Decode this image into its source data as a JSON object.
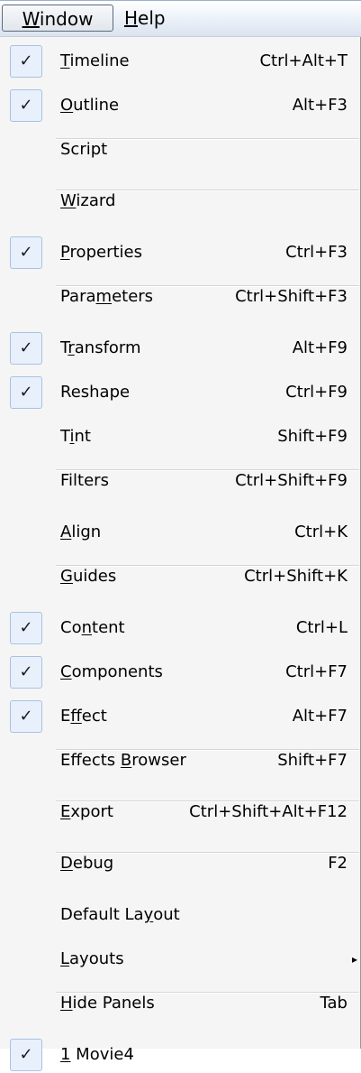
{
  "menubar": {
    "window_label": "Window",
    "help_label": "Help"
  },
  "menu": {
    "check_mark": "✓",
    "submenu_arrow": "▸",
    "items": [
      {
        "label": "Timeline",
        "mnemonic": "T",
        "shortcut": "Ctrl+Alt+T",
        "checked": true
      },
      {
        "label": "Outline",
        "mnemonic": "O",
        "shortcut": "Alt+F3",
        "checked": true
      },
      {
        "label": "Script",
        "mnemonic": "",
        "shortcut": "",
        "checked": false
      },
      {
        "label": "Wizard",
        "mnemonic": "W",
        "shortcut": "",
        "checked": false
      },
      {
        "label": "Properties",
        "mnemonic": "P",
        "shortcut": "Ctrl+F3",
        "checked": true
      },
      {
        "label": "Parameters",
        "mnemonic": "m",
        "shortcut": "Ctrl+Shift+F3",
        "checked": false
      },
      {
        "label": "Transform",
        "mnemonic": "r",
        "shortcut": "Alt+F9",
        "checked": true
      },
      {
        "label": "Reshape",
        "mnemonic": "",
        "shortcut": "Ctrl+F9",
        "checked": true
      },
      {
        "label": "Tint",
        "mnemonic": "i",
        "shortcut": "Shift+F9",
        "checked": false
      },
      {
        "label": "Filters",
        "mnemonic": "",
        "shortcut": "Ctrl+Shift+F9",
        "checked": false
      },
      {
        "label": "Align",
        "mnemonic": "A",
        "shortcut": "Ctrl+K",
        "checked": false
      },
      {
        "label": "Guides",
        "mnemonic": "G",
        "shortcut": "Ctrl+Shift+K",
        "checked": false
      },
      {
        "label": "Content",
        "mnemonic": "n",
        "shortcut": "Ctrl+L",
        "checked": true
      },
      {
        "label": "Components",
        "mnemonic": "C",
        "shortcut": "Ctrl+F7",
        "checked": true
      },
      {
        "label": "Effect",
        "mnemonic": "f",
        "shortcut": "Alt+F7",
        "checked": true
      },
      {
        "label": "Effects Browser",
        "mnemonic": "B",
        "shortcut": "Shift+F7",
        "checked": false
      },
      {
        "label": "Export",
        "mnemonic": "E",
        "shortcut": "Ctrl+Shift+Alt+F12",
        "checked": false
      },
      {
        "label": "Debug",
        "mnemonic": "D",
        "shortcut": "F2",
        "checked": false
      },
      {
        "label": "Default Layout",
        "mnemonic": "y",
        "shortcut": "",
        "checked": false
      },
      {
        "label": "Layouts",
        "mnemonic": "L",
        "shortcut": "",
        "checked": false,
        "submenu": true
      },
      {
        "label": "Hide Panels",
        "mnemonic": "H",
        "shortcut": "Tab",
        "checked": false
      },
      {
        "label": "1 Movie4",
        "mnemonic": "1",
        "shortcut": "",
        "checked": true
      }
    ]
  }
}
